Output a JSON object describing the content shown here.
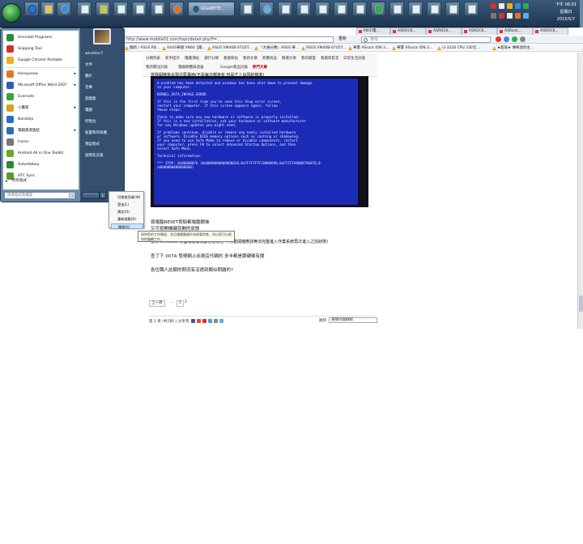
{
  "taskbar": {
    "active_window_label": "GIGABYTE...",
    "clock_time": "下午 06:01",
    "clock_day": "星期日",
    "clock_date": "2015/5/7"
  },
  "browser": {
    "url": "http://www.mobile01.com/topicdetail.php?f=...",
    "refresh_label": "重新",
    "search_placeholder": "搜尋",
    "tabs": [
      {
        "label": "M01/電..."
      },
      {
        "label": "ASROCK..."
      },
      {
        "label": "ASROCK..."
      },
      {
        "label": "ASROCK..."
      },
      {
        "label": "ASRock..."
      },
      {
        "label": "ASROCK..."
      }
    ],
    "bookmarks": [
      {
        "label": "翻新 / ASUS R8..."
      },
      {
        "label": "ASUS華碩 VN60【最..."
      },
      {
        "label": "ASUS VM40B-07U5T..."
      },
      {
        "label": "『大通分類』ASUS 華..."
      },
      {
        "label": "ASUS VM40B-07U5T..."
      },
      {
        "label": "華擎 ASrock ION 3..."
      },
      {
        "label": "華擎 ASrock ION 3..."
      },
      {
        "label": "i3-3220 CPU 330元..."
      },
      {
        "label": "★超值★ 傳奇迷你主..."
      }
    ]
  },
  "forum": {
    "nav_row1": [
      "分類列表",
      "新手提示",
      "隱藏頂帖",
      "選行分類",
      "看最新帖",
      "看新文章",
      "熱賣商品",
      "精選文章",
      "我的最愛",
      "看最新影音",
      "日常生活討論"
    ],
    "nav_row2": [
      "我的關注討論",
      "電腦硬體與週邊",
      "Google產品討論",
      "熱門文章"
    ],
    "headline": "當我開機後出現這藍畫面(不是每次都會有 但是千上出現的機率)",
    "bsod_lines": [
      "A problem has been detected and windows has been shut down to prevent damage",
      "to your computer.",
      "",
      "KERNEL_DATA_INPAGE_ERROR",
      "",
      "If this is the first time you've seen this Stop error screen,",
      "restart your computer. If this screen appears again, follow",
      "these steps:",
      "",
      "Check to make sure any new hardware or software is properly installed.",
      "If this is a new installation, ask your hardware or software manufacturer",
      "for any Windows updates you might need.",
      "",
      "If problems continue, disable or remove any newly installed hardware",
      "or software. Disable BIOS memory options such as caching or shadowing.",
      "If you need to use Safe Mode to remove or disable components, restart",
      "your computer, press F8 to select Advanced Startup Options, and then",
      "select Safe Mode.",
      "",
      "Technical information:",
      "",
      "*** STOP: 0x0000007A (0x0000000000000020,0xFFFFFFFFC0000098,0xFFFFFA8008796078,0",
      "x0000000000000000)"
    ],
    "post_lines": [
      "按電腦RESET按鈕都電腦關後",
      "又可按開機鍵就開的狀態",
      "按到 Windows 桌面或是開機都會很奇怪 不然重開機應該無法完整進入作業系統再次進入之前狀態)",
      "查了下 007A 發現網上出現這代碼的 多半都是跟硬碟有關",
      "各位職人此類的問況有沒遇到類似問題的?"
    ],
    "pager": [
      "上一頁",
      "...",
      "1",
      "2"
    ],
    "share_text": "第 2 頁 (共2頁) | 分享到",
    "goto_label": "跳到",
    "goto_value": "選擇討論群組"
  },
  "start_menu": {
    "left_items": [
      {
        "label": "Uninstall Programs",
        "color": "#2a8a3a"
      },
      {
        "label": "Snipping Tool",
        "color": "#c33"
      },
      {
        "label": "Google Chrome Portable",
        "color": "#e9b020"
      },
      {
        "label": "Honeyview",
        "color": "#e07a20",
        "arrow": "▸"
      },
      {
        "label": "Microsoft Office Word 2007",
        "color": "#2b5fb4",
        "arrow": "▸"
      },
      {
        "label": "Evernote",
        "color": "#3aa23a"
      },
      {
        "label": "小畫家",
        "color": "#d9a020",
        "arrow": "▸"
      },
      {
        "label": "Bandizip",
        "color": "#1e70c8"
      },
      {
        "label": "電腦資源連結",
        "color": "#2a6fb4",
        "arrow": "▸"
      },
      {
        "label": "Icaros",
        "color": "#777"
      },
      {
        "label": "Android All in One Toolkit",
        "color": "#6aa82a"
      },
      {
        "label": "AutoHotkey",
        "color": "#2a8a3a"
      },
      {
        "label": "HTC Sync",
        "color": "#5a9a2a"
      }
    ],
    "all_programs": "所有程式",
    "search_placeholder": "搜尋程式及檔案",
    "right_items": [
      "windstar7",
      "文件",
      "圖片",
      "音樂",
      "遊戲集",
      "電腦",
      "控制台",
      "裝置和印表機",
      "預設程式",
      "說明及支援"
    ]
  },
  "shutdown_menu": {
    "items": [
      "切換使用者(W)",
      "登出(L)",
      "鎖定(O)",
      "重新啟動(R)",
      "睡眠(S)"
    ],
    "highlighted_index": 4,
    "tooltip": "保持您的工作階段，並且讓電腦處於低耗電狀態，所以您可以很快地繼續工作。"
  }
}
